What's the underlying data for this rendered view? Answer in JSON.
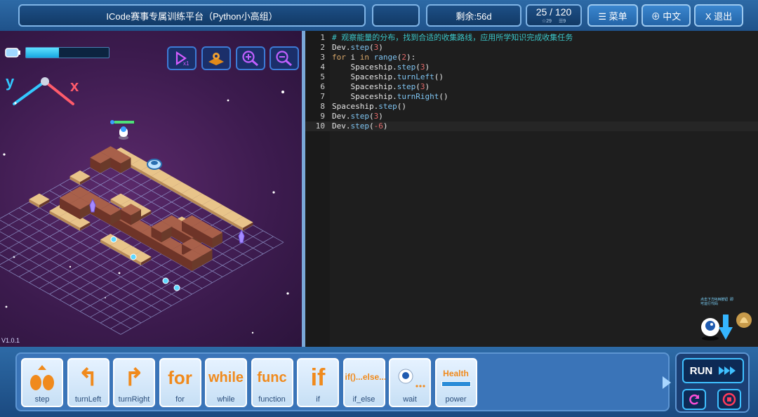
{
  "header": {
    "platform_title": "ICode赛事专属训练平台（Python小高组）",
    "blank_label": "",
    "remaining": "剩余:56d",
    "progress": {
      "main": "25 / 120",
      "stars": "29",
      "levels": "9"
    },
    "menu_label": "☰ 菜单",
    "lang_label": "⊕ 中文",
    "exit_label": "X 退出"
  },
  "game": {
    "energy_percent": 40,
    "axis_y": "y",
    "axis_x": "x",
    "tools": [
      {
        "icon": "playback-speed-icon"
      },
      {
        "icon": "map-view-icon"
      },
      {
        "icon": "zoom-in-icon"
      },
      {
        "icon": "zoom-out-icon"
      }
    ],
    "version": "V1.0.1"
  },
  "code": {
    "lines": [
      {
        "num": "1",
        "tokens": [
          {
            "t": "# 观察能量的分布，找到合适的收集路线，应用所学知识完成收集任务",
            "c": "comment"
          }
        ]
      },
      {
        "num": "2",
        "tokens": [
          {
            "t": "Dev.",
            "c": "plain"
          },
          {
            "t": "step",
            "c": "fn"
          },
          {
            "t": "(",
            "c": "plain"
          },
          {
            "t": "3",
            "c": "num"
          },
          {
            "t": ")",
            "c": "plain"
          }
        ]
      },
      {
        "num": "3",
        "tokens": [
          {
            "t": "for",
            "c": "kw"
          },
          {
            "t": " i ",
            "c": "plain"
          },
          {
            "t": "in",
            "c": "kw"
          },
          {
            "t": " ",
            "c": "plain"
          },
          {
            "t": "range",
            "c": "fn"
          },
          {
            "t": "(",
            "c": "plain"
          },
          {
            "t": "2",
            "c": "num"
          },
          {
            "t": "):",
            "c": "plain"
          }
        ]
      },
      {
        "num": "4",
        "tokens": [
          {
            "t": "    Spaceship.",
            "c": "plain"
          },
          {
            "t": "step",
            "c": "fn"
          },
          {
            "t": "(",
            "c": "plain"
          },
          {
            "t": "3",
            "c": "num"
          },
          {
            "t": ")",
            "c": "plain"
          }
        ]
      },
      {
        "num": "5",
        "tokens": [
          {
            "t": "    Spaceship.",
            "c": "plain"
          },
          {
            "t": "turnLeft",
            "c": "fn"
          },
          {
            "t": "()",
            "c": "plain"
          }
        ]
      },
      {
        "num": "6",
        "tokens": [
          {
            "t": "    Spaceship.",
            "c": "plain"
          },
          {
            "t": "step",
            "c": "fn"
          },
          {
            "t": "(",
            "c": "plain"
          },
          {
            "t": "3",
            "c": "num"
          },
          {
            "t": ")",
            "c": "plain"
          }
        ]
      },
      {
        "num": "7",
        "tokens": [
          {
            "t": "    Spaceship.",
            "c": "plain"
          },
          {
            "t": "turnRight",
            "c": "fn"
          },
          {
            "t": "()",
            "c": "plain"
          }
        ]
      },
      {
        "num": "8",
        "tokens": [
          {
            "t": "Spaceship.",
            "c": "plain"
          },
          {
            "t": "step",
            "c": "fn"
          },
          {
            "t": "()",
            "c": "plain"
          }
        ]
      },
      {
        "num": "9",
        "tokens": [
          {
            "t": "Dev.",
            "c": "plain"
          },
          {
            "t": "step",
            "c": "fn"
          },
          {
            "t": "(",
            "c": "plain"
          },
          {
            "t": "3",
            "c": "num"
          },
          {
            "t": ")",
            "c": "plain"
          }
        ]
      },
      {
        "num": "10",
        "tokens": [
          {
            "t": "Dev.",
            "c": "plain"
          },
          {
            "t": "step",
            "c": "fn"
          },
          {
            "t": "(",
            "c": "plain"
          },
          {
            "t": "-6",
            "c": "num"
          },
          {
            "t": ")",
            "c": "plain"
          }
        ]
      }
    ],
    "active_line": 10
  },
  "helper": {
    "hint": "点击下方RUN按钮 即可运行代码"
  },
  "blocks": [
    {
      "art": "",
      "label": "step",
      "icon": "step-icon"
    },
    {
      "art": "↰",
      "label": "turnLeft",
      "icon": "turn-left-icon"
    },
    {
      "art": "↱",
      "label": "turnRight",
      "icon": "turn-right-icon"
    },
    {
      "art": "for",
      "label": "for"
    },
    {
      "art": "while",
      "label": "while"
    },
    {
      "art": "func",
      "label": "function"
    },
    {
      "art": "if",
      "label": "if"
    },
    {
      "art": "if()...else...",
      "label": "if_else"
    },
    {
      "art": "",
      "label": "wait",
      "icon": "robot-wait-icon"
    },
    {
      "art": "Health",
      "label": "power"
    }
  ],
  "run": {
    "label": "RUN"
  }
}
